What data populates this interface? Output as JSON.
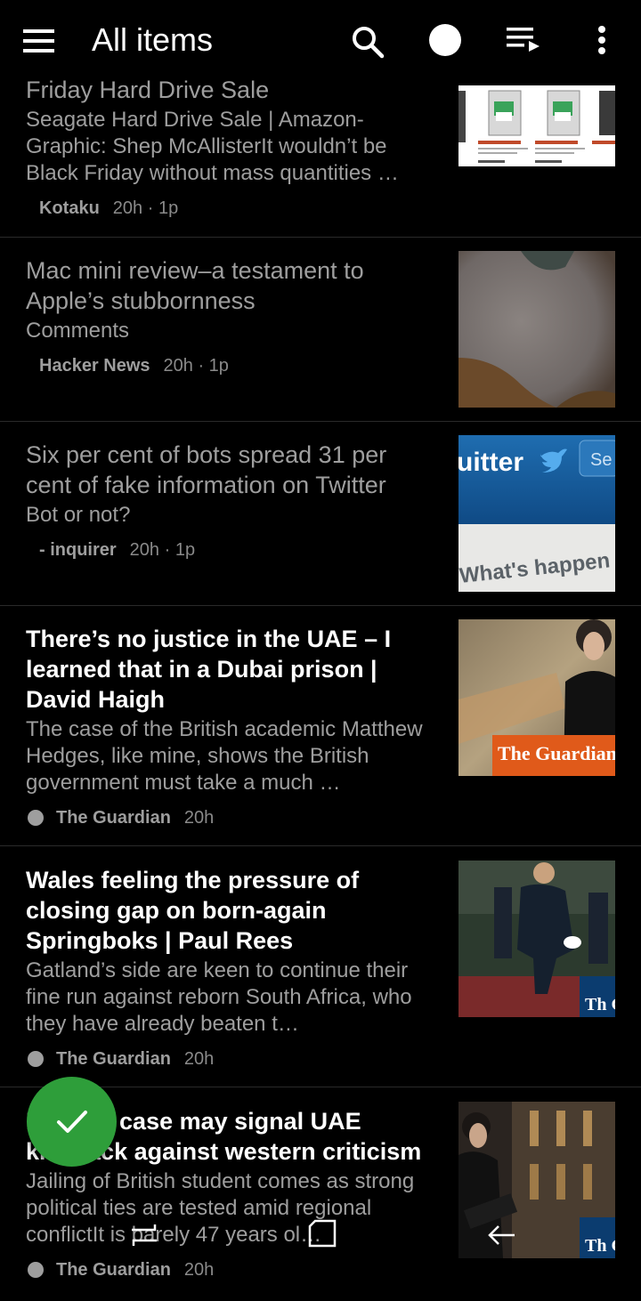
{
  "appbar": {
    "title": "All items",
    "icons": [
      "menu-icon",
      "search-icon",
      "circle-icon",
      "playlist-icon",
      "more-vert-icon"
    ]
  },
  "items": [
    {
      "title": "Friday Hard Drive Sale",
      "summary": "Seagate Hard Drive Sale | Amazon-Graphic: Shep McAllisterIt wouldn’t be Black Friday without mass quantities …",
      "source": "Kotaku",
      "time": "20h · 1p",
      "read": true
    },
    {
      "title": "Mac mini review–a testament to Apple’s stubbornness",
      "summary": "Comments",
      "source": "Hacker News",
      "time": "20h · 1p",
      "read": true
    },
    {
      "title": "Six per cent of bots spread 31 per cent of fake information on Twitter",
      "summary": "Bot or not?",
      "source": "- inquirer",
      "time": "20h · 1p",
      "read": true,
      "thumb_text_top": "uitter",
      "thumb_text_side": "Se",
      "thumb_text_bottom": "What's happen"
    },
    {
      "title": "There’s no justice in the UAE – I learned that in a Dubai prison | David Haigh",
      "summary": "The case of the British academic Matthew Hedges, like mine, shows the British government must take a much …",
      "source": "The Guardian",
      "time": "20h",
      "read": false,
      "thumb_text": "The Guardian Opi"
    },
    {
      "title": "Wales feeling the pressure of closing gap on born-again Springboks | Paul Rees",
      "summary": "Gatland’s side are keen to continue their fine run against reborn South Africa, who they have already beaten t…",
      "source": "The Guardian",
      "time": "20h",
      "read": false,
      "thumb_text": "Th Gu"
    },
    {
      "title": "Hedges case may signal UAE kickback against western criticism",
      "summary": "Jailing of British student comes as strong political ties are tested amid regional conflictIt is barely 47 years ol…",
      "source": "The Guardian",
      "time": "20h",
      "read": false,
      "thumb_text": "Th Gu"
    }
  ],
  "fab": {
    "icon": "check-icon",
    "color": "#2e9e3a"
  },
  "navbar": {
    "icons": [
      "recent-apps-icon",
      "home-icon",
      "back-icon"
    ]
  }
}
